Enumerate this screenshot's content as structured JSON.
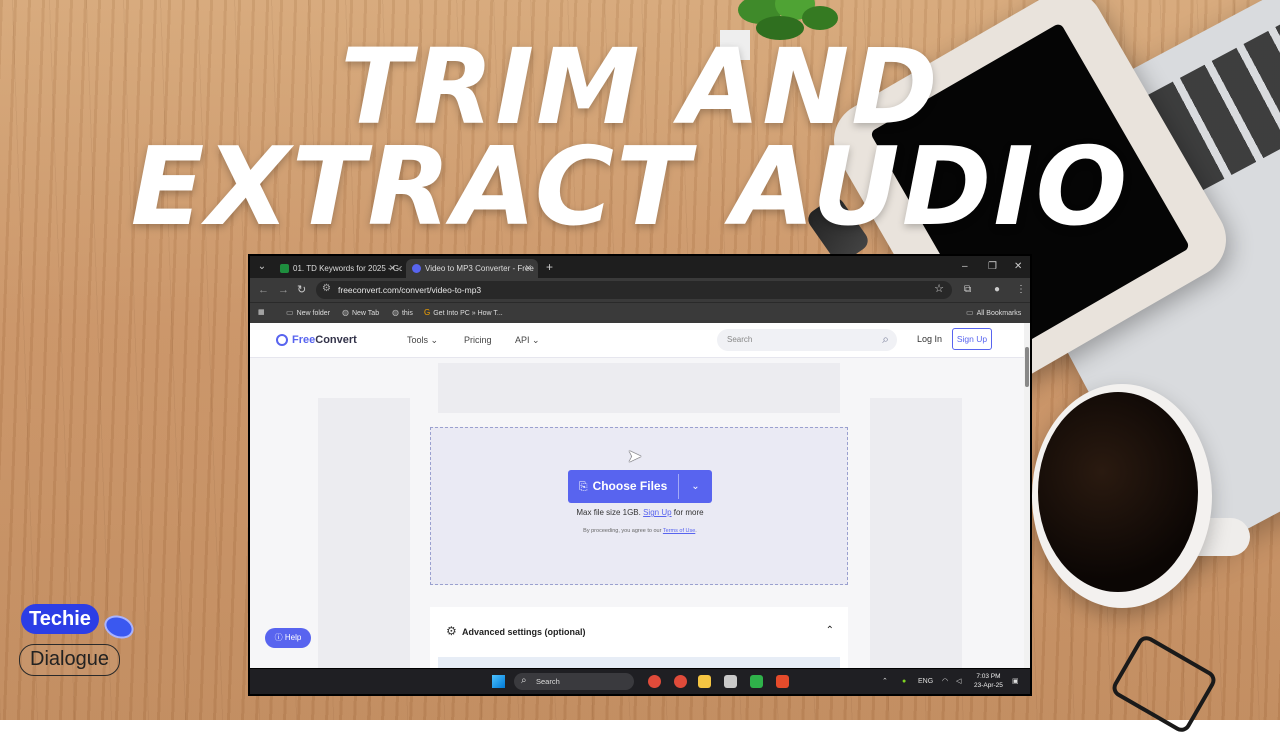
{
  "thumbnail": {
    "title_line1": "TRIM AND",
    "title_line2": "EXTRACT AUDIO",
    "brand_top": "Techie",
    "brand_bottom": "Dialogue"
  },
  "browser": {
    "tabs": [
      {
        "label": "01. TD Keywords for 2025 - Go",
        "favicon_color": "#1e8e3e"
      },
      {
        "label": "Video to MP3 Converter - Free",
        "favicon_color": "#5864ef"
      }
    ],
    "new_tab": "+",
    "url": "freeconvert.com/convert/video-to-mp3",
    "bookmarks": [
      {
        "label": "New folder",
        "icon": "folder-icon"
      },
      {
        "label": "New Tab",
        "icon": "globe-icon"
      },
      {
        "label": "this",
        "icon": "globe-icon"
      },
      {
        "label": "Get Into PC » How T...",
        "icon": "g-icon"
      }
    ],
    "all_bookmarks": "All Bookmarks"
  },
  "site": {
    "logo_free": "Free",
    "logo_convert": "Convert",
    "nav": [
      "Tools ⌄",
      "Pricing",
      "API ⌄"
    ],
    "search_placeholder": "Search",
    "login": "Log In",
    "signup": "Sign Up",
    "choose_files": "Choose Files",
    "max_size_prefix": "Max file size 1GB.",
    "max_size_link": "Sign Up",
    "max_size_suffix": "for more",
    "terms_prefix": "By proceeding, you agree to our",
    "terms_link": "Terms of Use",
    "terms_suffix": ".",
    "advanced": "Advanced settings (optional)",
    "help": "Help",
    "accent_color": "#5864ef"
  },
  "taskbar": {
    "search": "Search",
    "lang": "ENG",
    "time": "7:03 PM",
    "date": "23-Apr-25"
  }
}
